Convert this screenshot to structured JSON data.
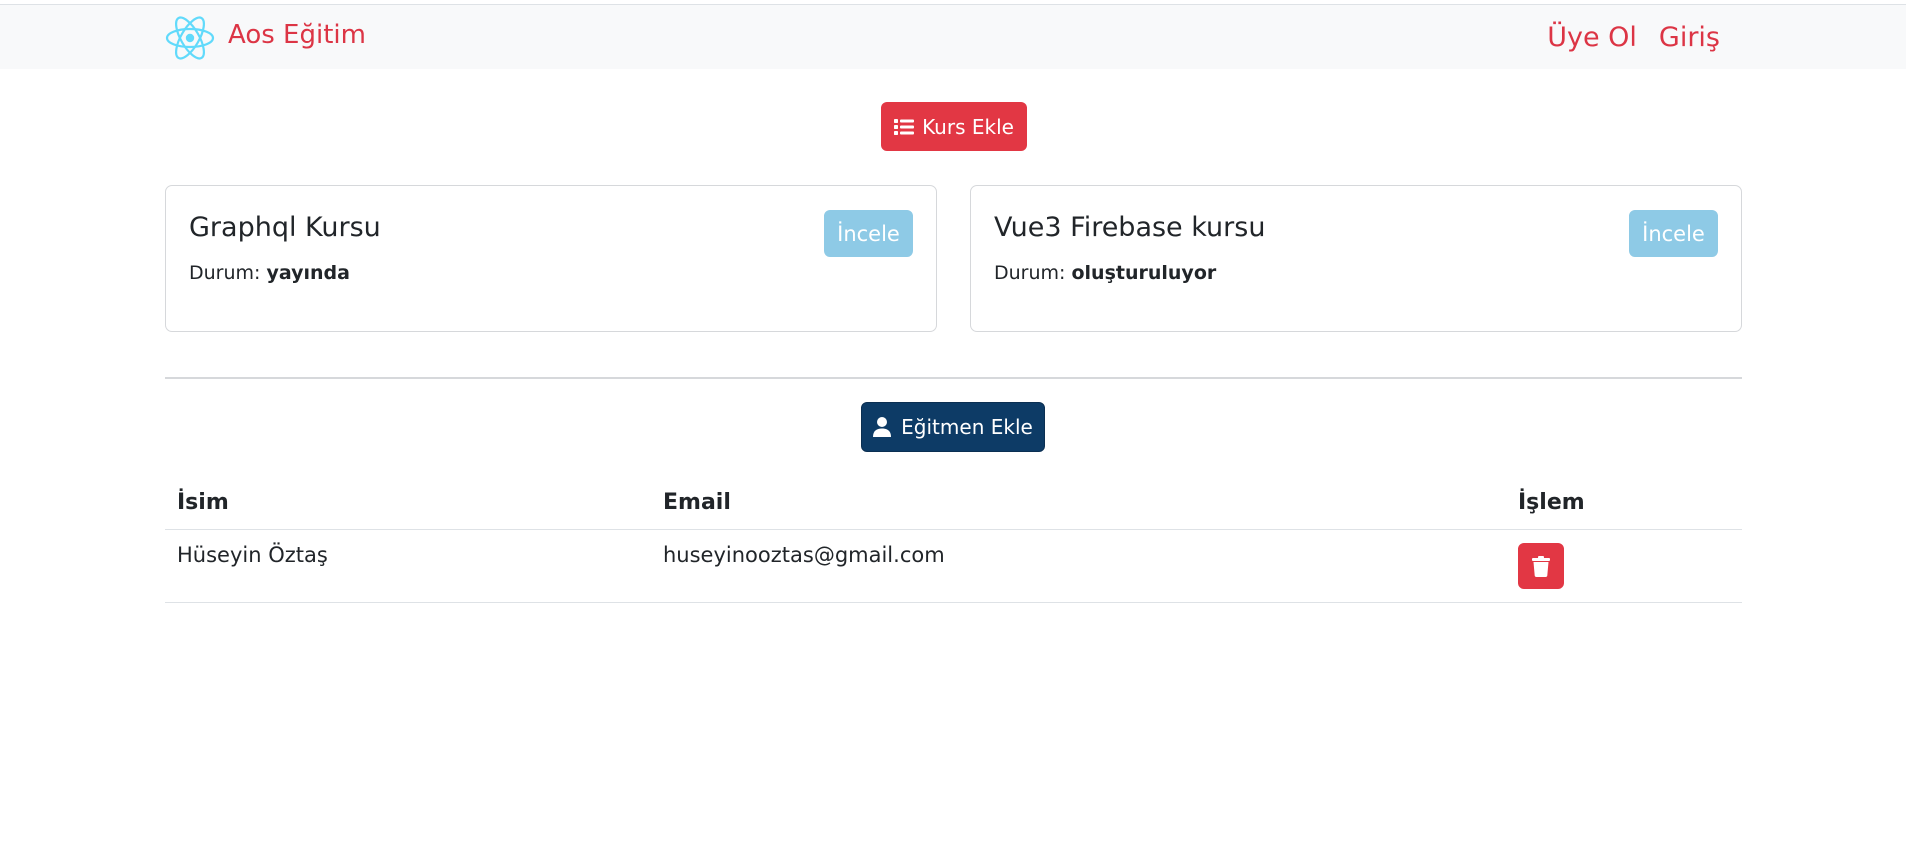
{
  "navbar": {
    "brand": "Aos Eğitim",
    "links": [
      "Üye Ol",
      "Giriş"
    ]
  },
  "actions": {
    "add_course": "Kurs Ekle",
    "add_trainer": "Eğitmen Ekle"
  },
  "courses": [
    {
      "title": "Graphql Kursu",
      "status_label": "Durum:",
      "status": "yayında",
      "button": "İncele"
    },
    {
      "title": "Vue3 Firebase kursu",
      "status_label": "Durum:",
      "status": "oluşturuluyor",
      "button": "İncele"
    }
  ],
  "trainers": {
    "headers": [
      "İsim",
      "Email",
      "İşlem"
    ],
    "rows": [
      {
        "name": "Hüseyin Öztaş",
        "email": "huseyinooztas@gmail.com"
      }
    ]
  },
  "colors": {
    "brand": "#dc3545",
    "danger": "#e23744",
    "navy": "#0d3b66",
    "info": "#8ecae6",
    "react_logo": "#61dafb"
  },
  "icons": {
    "brand": "react-atom-icon",
    "add_course": "list-icon",
    "add_trainer": "user-icon",
    "delete": "trash-icon"
  }
}
